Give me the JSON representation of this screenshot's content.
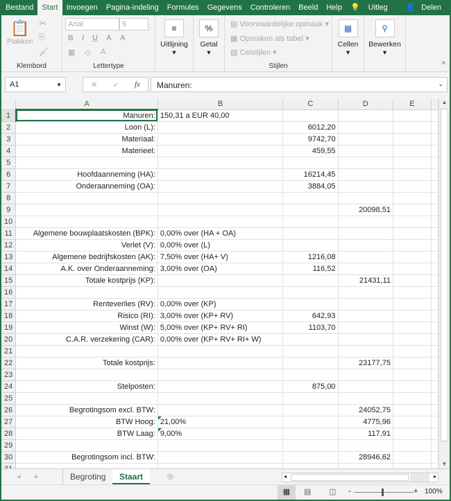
{
  "ribbon_tabs": [
    "Bestand",
    "Start",
    "Invoegen",
    "Pagina-indeling",
    "Formules",
    "Gegevens",
    "Controleren",
    "Beeld",
    "Help"
  ],
  "tell_me": "Uitleg",
  "share": "Delen",
  "clipboard": {
    "paste": "Plakken",
    "label": "Klembord"
  },
  "font": {
    "name": "Arial",
    "size": "9",
    "bold": "B",
    "italic": "I",
    "underline": "U",
    "grow": "A",
    "shrink": "A",
    "color": "A",
    "label": "Lettertype"
  },
  "alignment": "Uitlijning",
  "number": "Getal",
  "number_icon": "%",
  "styles": {
    "conditional": "Voorwaardelijke opmaak",
    "table": "Opmaken als tabel",
    "cell_styles": "Celstijlen",
    "label": "Stijlen"
  },
  "cells": "Cellen",
  "editing": "Bewerken",
  "formula_bar": {
    "name_box": "A1",
    "fx": "fx",
    "value": "Manuren:"
  },
  "columns": [
    "A",
    "B",
    "C",
    "D",
    "E"
  ],
  "rows": [
    [
      "Manuren:",
      "150,31 a EUR 40,00",
      "",
      ""
    ],
    [
      "Loon (L):",
      "",
      "6012,20",
      ""
    ],
    [
      "Materiaal:",
      "",
      "9742,70",
      ""
    ],
    [
      "Materieel:",
      "",
      "459,55",
      ""
    ],
    [
      "",
      "",
      "",
      ""
    ],
    [
      "Hoofdaanneming (HA):",
      "",
      "16214,45",
      ""
    ],
    [
      "Onderaanneming (OA):",
      "",
      "3884,05",
      ""
    ],
    [
      "",
      "",
      "",
      ""
    ],
    [
      "",
      "",
      "",
      "20098,51"
    ],
    [
      "",
      "",
      "",
      ""
    ],
    [
      "Algemene bouwplaatskosten (BPK):",
      "0,00% over (HA + OA)",
      "",
      ""
    ],
    [
      "Verlet (V):",
      "0,00% over (L)",
      "",
      ""
    ],
    [
      "Algemene bedrijfskosten (AK):",
      "7,50% over (HA+ V)",
      "1216,08",
      ""
    ],
    [
      "A.K. over Onderaanneming:",
      "3,00% over (OA)",
      "116,52",
      ""
    ],
    [
      "Totale kostprijs (KP):",
      "",
      "",
      "21431,11"
    ],
    [
      "",
      "",
      "",
      ""
    ],
    [
      "Renteverlies (RV):",
      "0,00% over (KP)",
      "",
      ""
    ],
    [
      "Risico (RI):",
      "3,00% over (KP+ RV)",
      "642,93",
      ""
    ],
    [
      "Winst (W):",
      "5,00% over (KP+ RV+ RI)",
      "1103,70",
      ""
    ],
    [
      "C.A.R. verzekering (CAR):",
      "0,00% over (KP+ RV+ RI+ W)",
      "",
      ""
    ],
    [
      "",
      "",
      "",
      ""
    ],
    [
      "Totale kostprijs:",
      "",
      "",
      "23177,75"
    ],
    [
      "",
      "",
      "",
      ""
    ],
    [
      "Stelposten:",
      "",
      "875,00",
      ""
    ],
    [
      "",
      "",
      "",
      ""
    ],
    [
      "Begrotingsom excl. BTW:",
      "",
      "",
      "24052,75"
    ],
    [
      "BTW Hoog:",
      "21,00%",
      "",
      "4775,96"
    ],
    [
      "BTW Laag:",
      "9,00%",
      "",
      "117,91"
    ],
    [
      "",
      "",
      "",
      ""
    ],
    [
      "Begrotingsom incl. BTW:",
      "",
      "",
      "28946,62"
    ],
    [
      "",
      "",
      "",
      ""
    ]
  ],
  "sheets": [
    "Begroting",
    "Staart"
  ],
  "active_sheet": "Staart",
  "zoom": "100%",
  "accent": "#217346"
}
